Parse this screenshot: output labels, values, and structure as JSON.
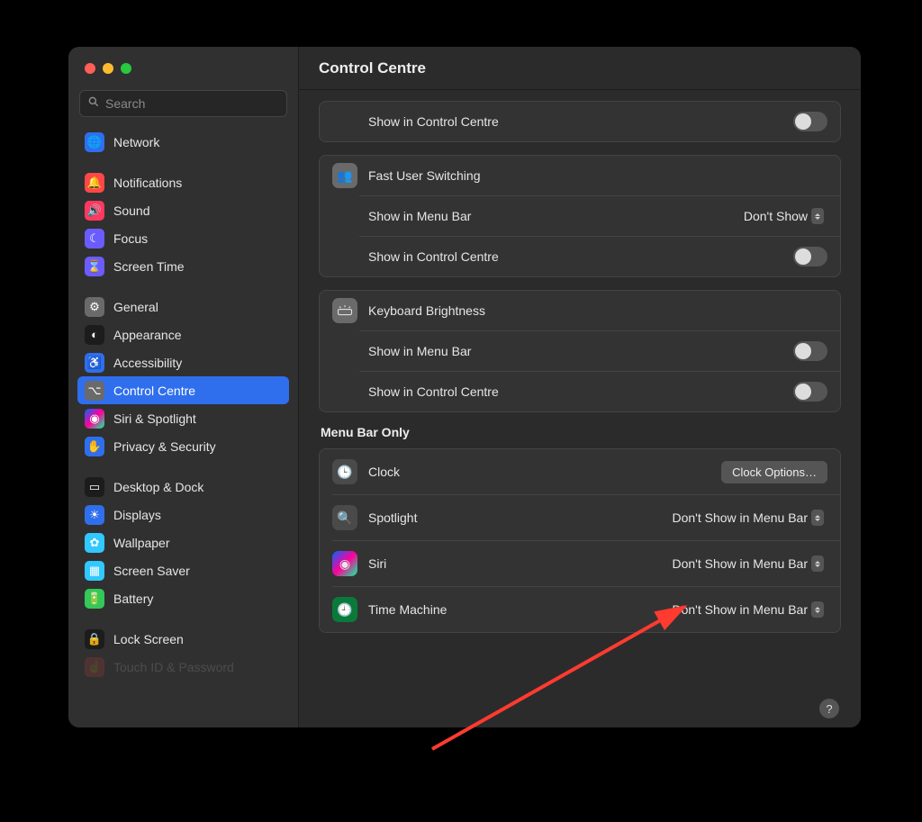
{
  "header": {
    "title": "Control Centre"
  },
  "search": {
    "placeholder": "Search"
  },
  "sidebar": {
    "groups": [
      {
        "items": [
          {
            "label": "Network",
            "icon": "🌐",
            "bg": "#2f6fed"
          }
        ]
      },
      {
        "items": [
          {
            "label": "Notifications",
            "icon": "🔔",
            "bg": "#ff4747"
          },
          {
            "label": "Sound",
            "icon": "🔊",
            "bg": "#ff3860"
          },
          {
            "label": "Focus",
            "icon": "☾",
            "bg": "#6b5cff"
          },
          {
            "label": "Screen Time",
            "icon": "⌛",
            "bg": "#6b5cff"
          }
        ]
      },
      {
        "items": [
          {
            "label": "General",
            "icon": "⚙",
            "bg": "#6a6a6a"
          },
          {
            "label": "Appearance",
            "icon": "◐",
            "bg": "#1c1c1c"
          },
          {
            "label": "Accessibility",
            "icon": "♿",
            "bg": "#2f6fed"
          },
          {
            "label": "Control Centre",
            "icon": "⌥",
            "bg": "#6a6a6a",
            "selected": true
          },
          {
            "label": "Siri & Spotlight",
            "icon": "◉",
            "bg": "linear-gradient(135deg,#06f,#f09,#0f9)"
          },
          {
            "label": "Privacy & Security",
            "icon": "✋",
            "bg": "#2f6fed"
          }
        ]
      },
      {
        "items": [
          {
            "label": "Desktop & Dock",
            "icon": "▭",
            "bg": "#1c1c1c"
          },
          {
            "label": "Displays",
            "icon": "☀",
            "bg": "#2f6fed"
          },
          {
            "label": "Wallpaper",
            "icon": "✿",
            "bg": "#30c8ff"
          },
          {
            "label": "Screen Saver",
            "icon": "▦",
            "bg": "#30c8ff"
          },
          {
            "label": "Battery",
            "icon": "🔋",
            "bg": "#34c759"
          }
        ]
      },
      {
        "items": [
          {
            "label": "Lock Screen",
            "icon": "🔒",
            "bg": "#1c1c1c"
          },
          {
            "label": "Touch ID & Password",
            "icon": "☝",
            "bg": "#ff4747",
            "cut": true
          }
        ]
      }
    ]
  },
  "main": {
    "topPanel": {
      "rows": [
        {
          "kind": "sub",
          "label": "Show in Control Centre",
          "control": "toggle"
        }
      ]
    },
    "fastUser": {
      "title": "Fast User Switching",
      "icon": "👥",
      "rows": [
        {
          "label": "Show in Menu Bar",
          "control": "select",
          "value": "Don't Show"
        },
        {
          "label": "Show in Control Centre",
          "control": "toggle"
        }
      ]
    },
    "keyboardBrightness": {
      "title": "Keyboard Brightness",
      "icon": "⌨",
      "rows": [
        {
          "label": "Show in Menu Bar",
          "control": "toggle"
        },
        {
          "label": "Show in Control Centre",
          "control": "toggle"
        }
      ]
    },
    "menuBarOnly": {
      "title": "Menu Bar Only",
      "items": [
        {
          "label": "Clock",
          "icon": "🕒",
          "control": "button",
          "value": "Clock Options…"
        },
        {
          "label": "Spotlight",
          "icon": "🔍",
          "control": "select",
          "value": "Don't Show in Menu Bar"
        },
        {
          "label": "Siri",
          "icon": "◉",
          "iconBg": "linear-gradient(135deg,#06f,#f09,#0f9)",
          "control": "select",
          "value": "Don't Show in Menu Bar"
        },
        {
          "label": "Time Machine",
          "icon": "🕘",
          "iconBg": "#0a7a3a",
          "control": "select",
          "value": "Don't Show in Menu Bar"
        }
      ]
    },
    "help": "?"
  }
}
